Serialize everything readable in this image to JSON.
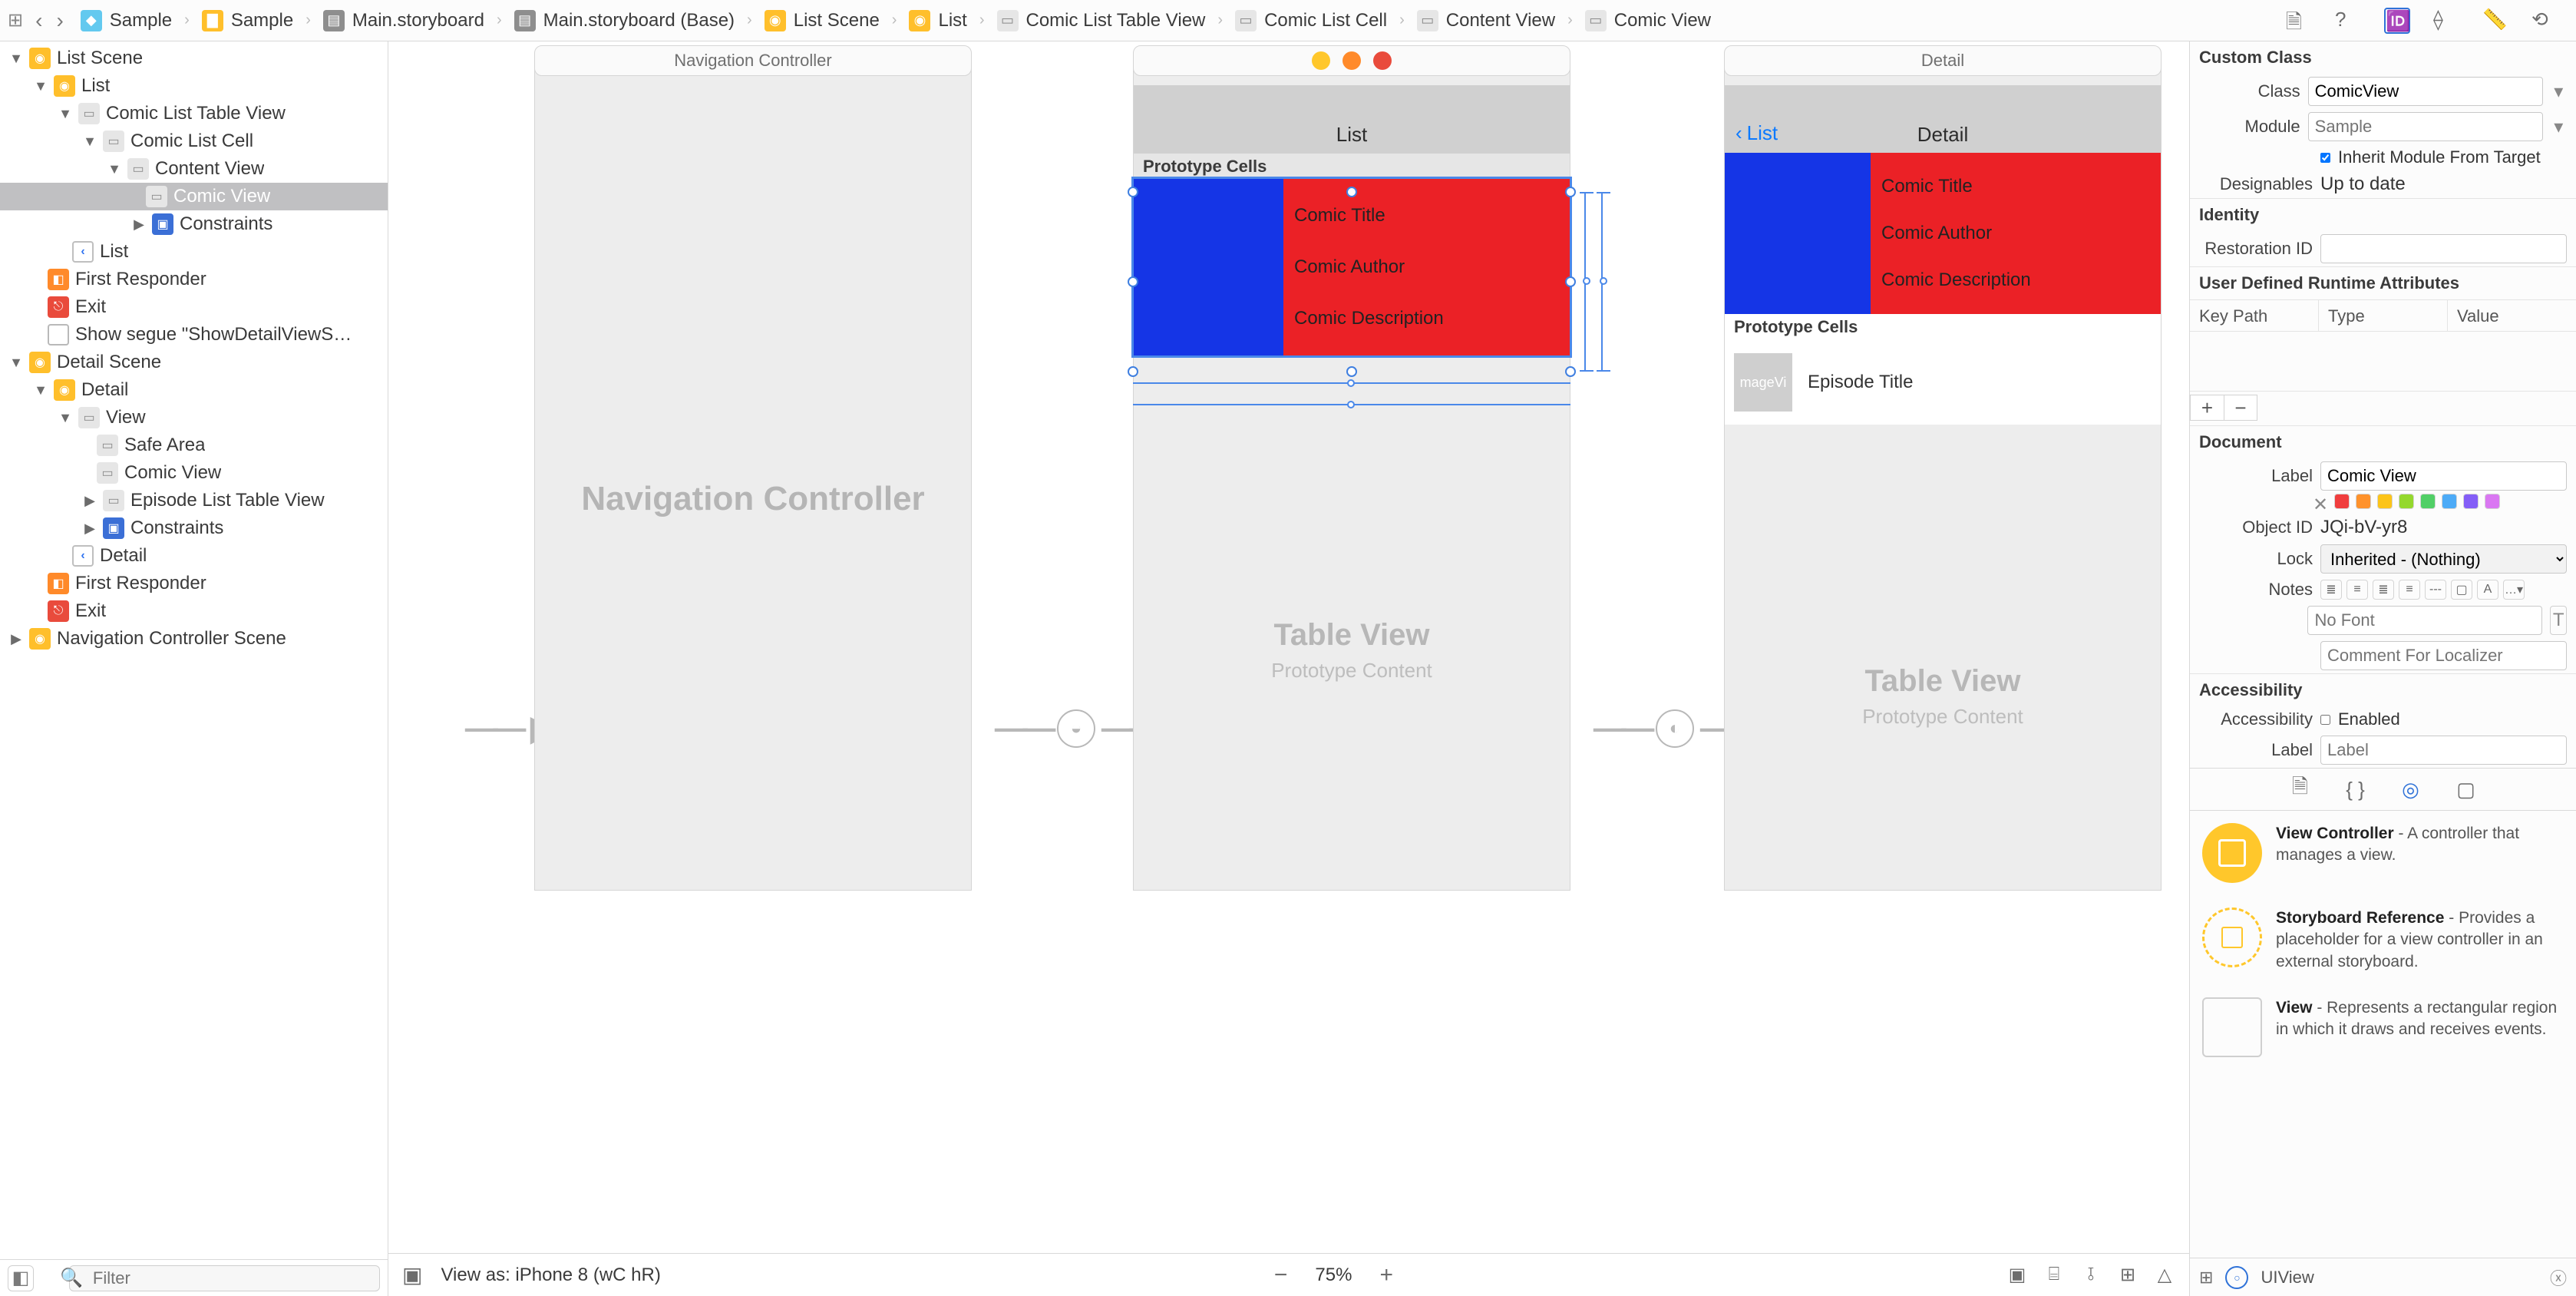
{
  "breadcrumb": {
    "items": [
      {
        "icon": "project",
        "label": "Sample"
      },
      {
        "icon": "folder",
        "label": "Sample"
      },
      {
        "icon": "storyboard",
        "label": "Main.storyboard"
      },
      {
        "icon": "storyboard",
        "label": "Main.storyboard (Base)"
      },
      {
        "icon": "scene",
        "label": "List Scene"
      },
      {
        "icon": "vc",
        "label": "List"
      },
      {
        "icon": "view",
        "label": "Comic List Table View"
      },
      {
        "icon": "view",
        "label": "Comic List Cell"
      },
      {
        "icon": "view",
        "label": "Content View"
      },
      {
        "icon": "view",
        "label": "Comic View"
      }
    ]
  },
  "outline": {
    "scenes": [
      {
        "name": "List Scene",
        "vc": "List",
        "children": [
          "Comic List Table View",
          "Comic List Cell",
          "Content View",
          "Comic View",
          "Constraints"
        ],
        "navitem": "List",
        "firstResponder": "First Responder",
        "exit": "Exit",
        "segue": "Show segue \"ShowDetailViewS…"
      },
      {
        "name": "Detail Scene",
        "vc": "Detail",
        "children": [
          "View",
          "Safe Area",
          "Comic View",
          "Episode List Table View",
          "Constraints"
        ],
        "navitem": "Detail",
        "firstResponder": "First Responder",
        "exit": "Exit"
      },
      {
        "name": "Navigation Controller Scene"
      }
    ],
    "filter_placeholder": "Filter",
    "selected": "Comic View"
  },
  "canvas": {
    "zoom": "75%",
    "viewAs": "View as: iPhone 8 (wC hR)",
    "scenes": {
      "nav": {
        "title": "Navigation Controller",
        "body": "Navigation Controller"
      },
      "list": {
        "title": "",
        "navTitle": "List",
        "protoHeader": "Prototype Cells",
        "cell": {
          "title": "Comic Title",
          "author": "Comic Author",
          "desc": "Comic Description"
        },
        "tv": "Table View",
        "tvSub": "Prototype Content"
      },
      "detail": {
        "title": "Detail",
        "back": "List",
        "cell": {
          "title": "Comic Title",
          "author": "Comic Author",
          "desc": "Comic Description"
        },
        "protoHeader": "Prototype Cells",
        "episode": {
          "img": "mageVi",
          "title": "Episode Title"
        },
        "tv": "Table View",
        "tvSub": "Prototype Content"
      }
    }
  },
  "inspector": {
    "customClass": {
      "header": "Custom Class",
      "classLabel": "Class",
      "classValue": "ComicView",
      "moduleLabel": "Module",
      "modulePlaceholder": "Sample",
      "inheritLabel": "Inherit Module From Target",
      "inheritChecked": true,
      "designablesLabel": "Designables",
      "designablesValue": "Up to date"
    },
    "identity": {
      "header": "Identity",
      "restorationLabel": "Restoration ID",
      "restorationValue": ""
    },
    "udra": {
      "header": "User Defined Runtime Attributes",
      "cols": [
        "Key Path",
        "Type",
        "Value"
      ]
    },
    "document": {
      "header": "Document",
      "labelLabel": "Label",
      "labelValue": "Comic View",
      "objectIdLabel": "Object ID",
      "objectIdValue": "JQi-bV-yr8",
      "lockLabel": "Lock",
      "lockValue": "Inherited - (Nothing)",
      "notesLabel": "Notes",
      "noFontPlaceholder": "No Font",
      "commentPlaceholder": "Comment For Localizer",
      "swatches": [
        "#f03e3e",
        "#ff922b",
        "#fcc419",
        "#94d82d",
        "#51cf66",
        "#4dabf7",
        "#845ef7",
        "#da77f2"
      ]
    },
    "accessibility": {
      "header": "Accessibility",
      "accLabel": "Accessibility",
      "enabled": "Enabled",
      "labelLabel": "Label",
      "labelPlaceholder": "Label"
    },
    "library": {
      "items": [
        {
          "kind": "vc",
          "name": "View Controller",
          "desc": " - A controller that manages a view."
        },
        {
          "kind": "sref",
          "name": "Storyboard Reference",
          "desc": " - Provides a placeholder for a view controller in an external storyboard."
        },
        {
          "kind": "view",
          "name": "View",
          "desc": " - Represents a rectangular region in which it draws and receives events."
        }
      ],
      "filterLabel": "UIView"
    }
  }
}
